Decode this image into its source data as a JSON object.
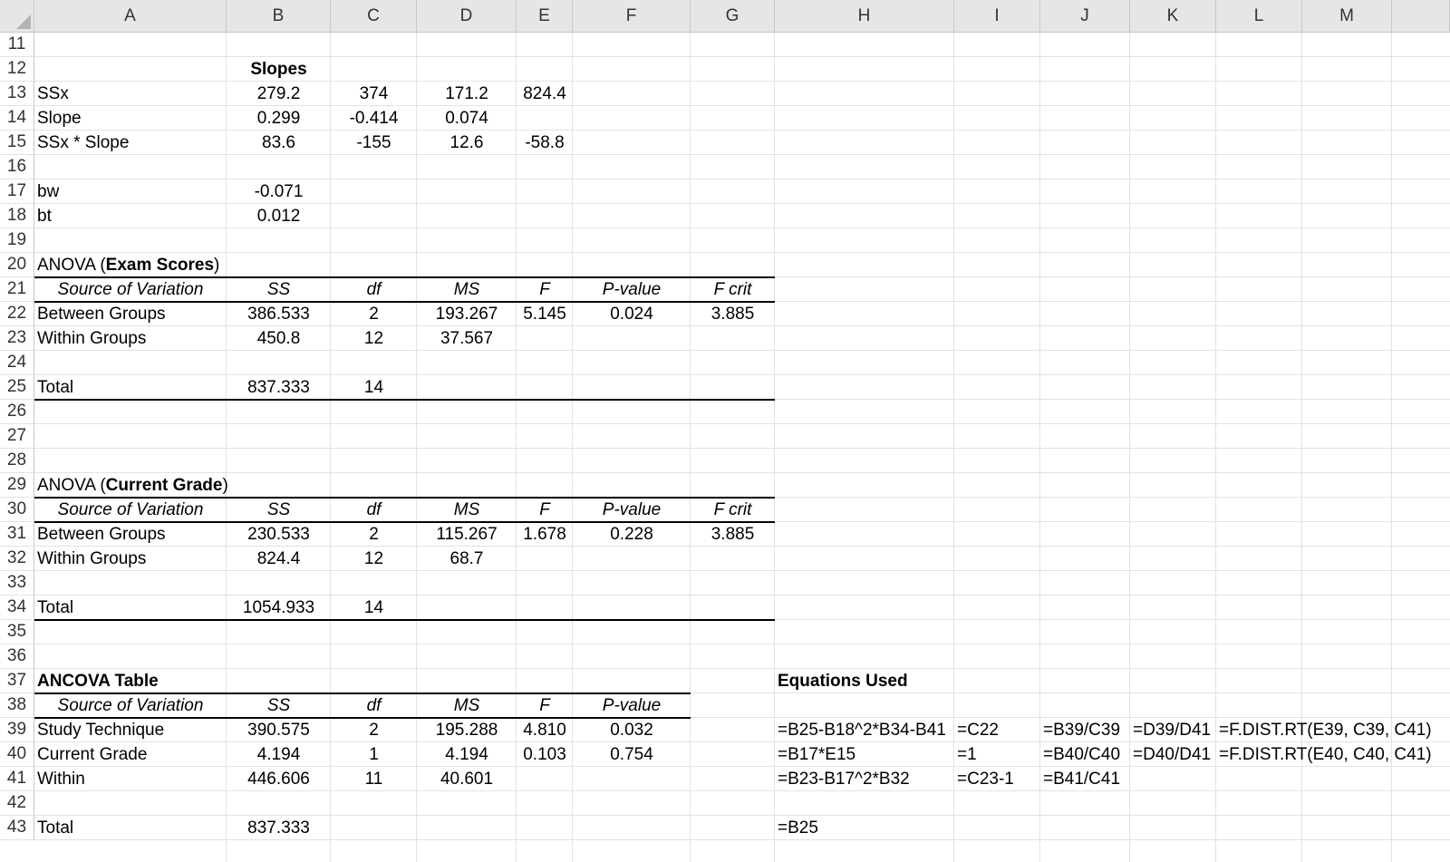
{
  "columns": [
    "A",
    "B",
    "C",
    "D",
    "E",
    "F",
    "G",
    "H",
    "I",
    "J",
    "K",
    "L",
    "M"
  ],
  "rows": [
    "11",
    "12",
    "13",
    "14",
    "15",
    "16",
    "17",
    "18",
    "19",
    "20",
    "21",
    "22",
    "23",
    "24",
    "25",
    "26",
    "27",
    "28",
    "29",
    "30",
    "31",
    "32",
    "33",
    "34",
    "35",
    "36",
    "37",
    "38",
    "39",
    "40",
    "41",
    "42",
    "43"
  ],
  "slopes": {
    "title": "Slopes",
    "ssx_label": "SSx",
    "slope_label": "Slope",
    "ssx_slope_label": "SSx * Slope",
    "ssx": [
      "279.2",
      "374",
      "171.2",
      "824.4"
    ],
    "slope": [
      "0.299",
      "-0.414",
      "0.074"
    ],
    "ssx_slope": [
      "83.6",
      "-155",
      "12.6",
      "-58.8"
    ],
    "bw_label": "bw",
    "bw": "-0.071",
    "bt_label": "bt",
    "bt": "0.012"
  },
  "anova_exam": {
    "title_prefix": "ANOVA (",
    "title_bold": "Exam Scores",
    "title_suffix": ")",
    "headers": [
      "Source of Variation",
      "SS",
      "df",
      "MS",
      "F",
      "P-value",
      "F crit"
    ],
    "rows": [
      [
        "Between Groups",
        "386.533",
        "2",
        "193.267",
        "5.145",
        "0.024",
        "3.885"
      ],
      [
        "Within Groups",
        "450.8",
        "12",
        "37.567",
        "",
        "",
        ""
      ]
    ],
    "total": [
      "Total",
      "837.333",
      "14"
    ]
  },
  "anova_grade": {
    "title_prefix": "ANOVA (",
    "title_bold": "Current Grade",
    "title_suffix": ")",
    "headers": [
      "Source of Variation",
      "SS",
      "df",
      "MS",
      "F",
      "P-value",
      "F crit"
    ],
    "rows": [
      [
        "Between Groups",
        "230.533",
        "2",
        "115.267",
        "1.678",
        "0.228",
        "3.885"
      ],
      [
        "Within Groups",
        "824.4",
        "12",
        "68.7",
        "",
        "",
        ""
      ]
    ],
    "total": [
      "Total",
      "1054.933",
      "14"
    ]
  },
  "ancova": {
    "title": "ANCOVA Table",
    "headers": [
      "Source of Variation",
      "SS",
      "df",
      "MS",
      "F",
      "P-value"
    ],
    "rows": [
      [
        "Study Technique",
        "390.575",
        "2",
        "195.288",
        "4.810",
        "0.032"
      ],
      [
        "Current Grade",
        "4.194",
        "1",
        "4.194",
        "0.103",
        "0.754"
      ],
      [
        "Within",
        "446.606",
        "11",
        "40.601",
        "",
        ""
      ]
    ],
    "total": [
      "Total",
      "837.333"
    ]
  },
  "equations": {
    "title": "Equations Used",
    "row39": [
      "=B25-B18^2*B34-B41",
      "=C22",
      "=B39/C39",
      "=D39/D41",
      "=F.DIST.RT(E39, C39, C41)"
    ],
    "row40": [
      "=B17*E15",
      "=1",
      "=B40/C40",
      "=D40/D41",
      "=F.DIST.RT(E40, C40, C41)"
    ],
    "row41": [
      "=B23-B17^2*B32",
      "=C23-1",
      "=B41/C41"
    ],
    "row43": [
      "=B25"
    ]
  }
}
